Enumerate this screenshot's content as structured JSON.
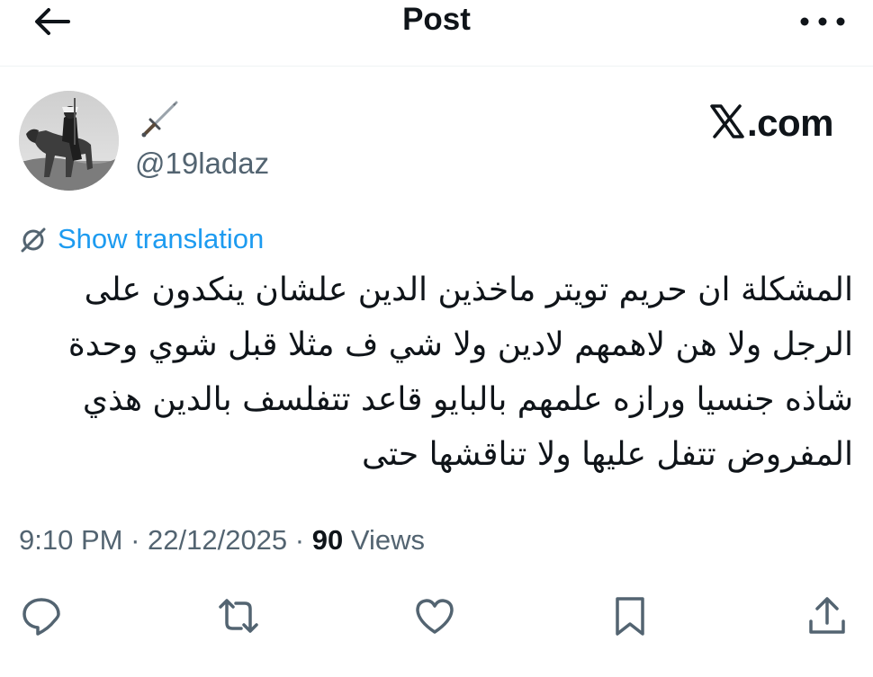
{
  "header": {
    "title": "Post",
    "back_icon": "arrow-left-icon",
    "more_icon": "more-horizontal-icon"
  },
  "author": {
    "display_name_icon": "dagger-icon",
    "handle": "@19ladaz",
    "avatar": "avatar-image"
  },
  "brand": {
    "label": ".com",
    "icon": "x-logo-icon"
  },
  "translation": {
    "label": "Show translation",
    "icon": "translate-icon",
    "color": "#1d9bf0"
  },
  "tweet": {
    "lines": [
      "المشكلة ان حريم تويتر ماخذين الدين علشان ينكدون على",
      "الرجل ولا هن لاهمهم لادين ولا شي ف مثلا قبل شوي وحدة",
      "شاذه جنسيا ورازه علمهم بالبايو قاعد تتفلسف بالدين هذي",
      "المفروض تتفل عليها ولا تناقشها حتى"
    ]
  },
  "meta": {
    "time": "9:10 PM",
    "sep1": " · ",
    "date": "22/12/2025",
    "sep2": " · ",
    "views_count": "90",
    "views_label": " Views"
  },
  "actions": [
    "reply-icon",
    "repost-icon",
    "like-icon",
    "bookmark-icon",
    "share-icon"
  ],
  "colors": {
    "text": "#0f1419",
    "secondary": "#536471",
    "divider": "#eff3f4",
    "link": "#1d9bf0"
  }
}
